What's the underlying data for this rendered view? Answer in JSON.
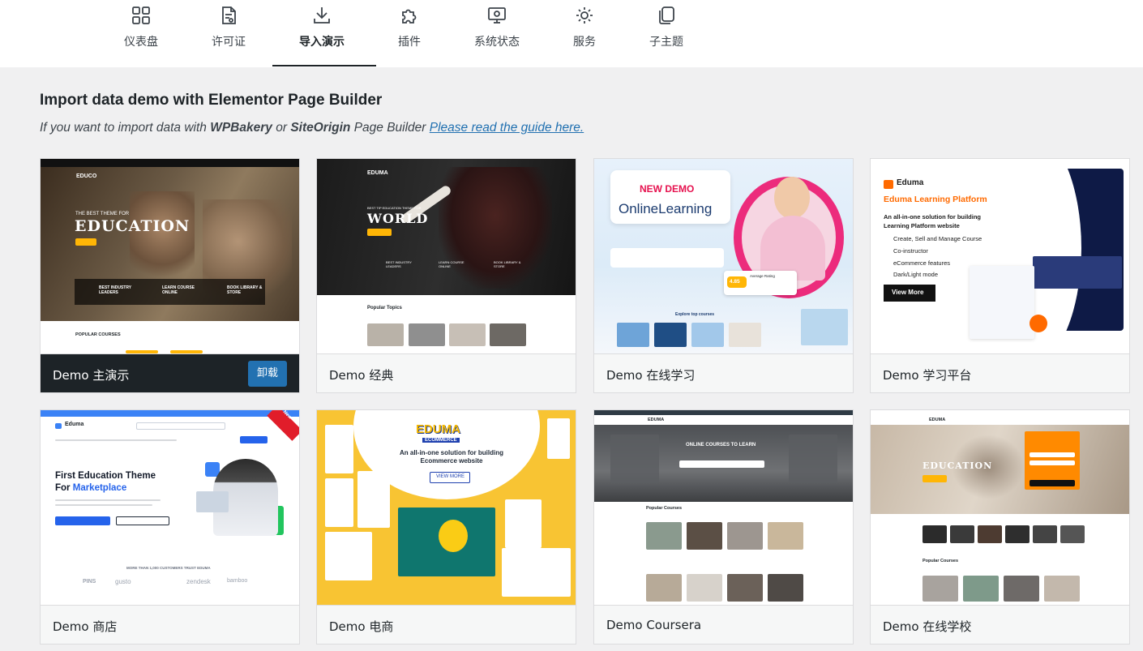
{
  "nav": {
    "tabs": [
      {
        "label": "仪表盘",
        "icon": "dashboard-grid-icon",
        "active": false
      },
      {
        "label": "许可证",
        "icon": "license-document-icon",
        "active": false
      },
      {
        "label": "导入演示",
        "icon": "download-icon",
        "active": true
      },
      {
        "label": "插件",
        "icon": "plugin-puzzle-icon",
        "active": false
      },
      {
        "label": "系统状态",
        "icon": "system-status-monitor-icon",
        "active": false
      },
      {
        "label": "服务",
        "icon": "service-gear-icon",
        "active": false
      },
      {
        "label": "子主题",
        "icon": "child-theme-copy-icon",
        "active": false
      }
    ]
  },
  "header": {
    "title": "Import data demo with Elementor Page Builder",
    "subtitle_part1": "If you want to import data with ",
    "subtitle_bold1": "WPBakery",
    "subtitle_part2": " or ",
    "subtitle_bold2": "SiteOrigin",
    "subtitle_part3": " Page Builder ",
    "subtitle_link": "Please read the guide here."
  },
  "demos": [
    {
      "name": "Demo 主演示",
      "current": true,
      "action_label": "卸载",
      "thumb": {
        "brand": "EDUCO",
        "hero_small": "THE BEST THEME FOR",
        "hero": "EDUCATION",
        "features": [
          "BEST INDUSTRY LEADERS",
          "LEARN COURSE ONLINE",
          "BOOK LIBRARY & STORE"
        ],
        "section": "POPULAR COURSES"
      }
    },
    {
      "name": "Demo 经典",
      "current": false,
      "thumb": {
        "brand": "EDUMA",
        "hero_small": "BEST TIP EDUCATION THEME FOR",
        "hero": "WORLD",
        "features": [
          "BEST INDUSTRY LEADERS",
          "LEARN COURSE ONLINE",
          "BOOK LIBRARY & STORE"
        ],
        "section": "Popular Topics"
      }
    },
    {
      "name": "Demo 在线学习",
      "current": false,
      "thumb": {
        "badge": "NEW DEMO",
        "hero": "OnlineLearning",
        "rating": "4.85",
        "rating_label": "Average Rating",
        "section": "Explore top courses"
      }
    },
    {
      "name": "Demo 学习平台",
      "current": false,
      "thumb": {
        "brand": "Eduma",
        "hero": "Eduma Learning Platform",
        "desc": "An all-in-one solution for building Learning Platform website",
        "bullets": [
          "Create, Sell and Manage Course",
          "Co-instructor",
          "eCommerce features",
          "Dark/Light mode"
        ],
        "cta": "View More"
      }
    },
    {
      "name": "Demo 商店",
      "current": false,
      "thumb": {
        "brand": "Eduma",
        "ribbon": "New",
        "hero_line1": "First Education Theme",
        "hero_line2": "For ",
        "hero_accent": "Marketplace",
        "logos": [
          "PINS",
          "gusto",
          "zendesk",
          "bamboo"
        ],
        "trust": "MORE THAN 1,000 CUSTOMERS TRUST EDUMA"
      }
    },
    {
      "name": "Demo 电商",
      "current": false,
      "thumb": {
        "brand": "EDUMA",
        "brand_sub": "ECOMMERCE",
        "hero": "An all-in-one solution for building Ecommerce website",
        "cta": "VIEW MORE"
      }
    },
    {
      "name": "Demo Coursera",
      "current": false,
      "thumb": {
        "brand": "EDUMA",
        "hero": "ONLINE COURSES TO LEARN",
        "section": "Popular Courses"
      }
    },
    {
      "name": "Demo 在线学校",
      "current": false,
      "thumb": {
        "brand": "EDUMA",
        "hero": "EDUCATION",
        "section": "Popular Courses"
      }
    }
  ],
  "colors": {
    "accent": "#2271b1",
    "current_bar": "#1d2327",
    "background": "#f0f0f1"
  }
}
